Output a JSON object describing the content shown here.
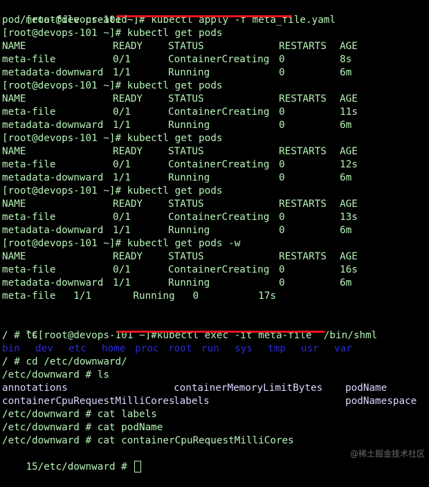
{
  "terminal": {
    "cmd_apply": "[root@devops-101 ~]# kubectl apply -f meta_file.yaml",
    "apply_out": "pod/meta-file created",
    "prompt_get": "[root@devops-101 ~]# kubectl get pods",
    "prompt_watch": "[root@devops-101 ~]# kubectl get pods -w",
    "headers": [
      "NAME",
      "READY",
      "STATUS",
      "RESTARTS",
      "AGE"
    ],
    "snapshots": [
      [
        [
          "meta-file",
          "0/1",
          "ContainerCreating",
          "0",
          "8s"
        ],
        [
          "metadata-downward",
          "1/1",
          "Running",
          "0",
          "6m"
        ]
      ],
      [
        [
          "meta-file",
          "0/1",
          "ContainerCreating",
          "0",
          "11s"
        ],
        [
          "metadata-downward",
          "1/1",
          "Running",
          "0",
          "6m"
        ]
      ],
      [
        [
          "meta-file",
          "0/1",
          "ContainerCreating",
          "0",
          "12s"
        ],
        [
          "metadata-downward",
          "1/1",
          "Running",
          "0",
          "6m"
        ]
      ],
      [
        [
          "meta-file",
          "0/1",
          "ContainerCreating",
          "0",
          "13s"
        ],
        [
          "metadata-downward",
          "1/1",
          "Running",
          "0",
          "6m"
        ]
      ],
      [
        [
          "meta-file",
          "0/1",
          "ContainerCreating",
          "0",
          "16s"
        ],
        [
          "metadata-downward",
          "1/1",
          "Running",
          "0",
          "6m"
        ]
      ]
    ],
    "watch_update": "meta-file   1/1       Running   0          17s",
    "cmd_exec": "^C[root@devops-101 ~]#kubectl exec -it meta-file  /bin/shml",
    "shell_prompt1": "/ # ls",
    "root_dirs": [
      "bin",
      "dev",
      "etc",
      "home",
      "proc",
      "root",
      "run",
      "sys",
      "tmp",
      "usr",
      "var"
    ],
    "cmd_cd": "/ # cd /etc/downward/",
    "cmd_ls2": "/etc/downward # ls",
    "downward_files": [
      [
        "annotations",
        "containerMemoryLimitBytes",
        "podName"
      ],
      [
        "containerCpuRequestMilliCores",
        "labels",
        "podNamespace"
      ]
    ],
    "cmd_cat_labels": "/etc/downward # cat labels",
    "cmd_cat_podname": "/etc/downward # cat podName",
    "cmd_cat_cpu": "/etc/downward # cat containerCpuRequestMilliCores",
    "final_prompt": "15/etc/downward # ",
    "watermark": "@稀土掘金技术社区"
  },
  "colors": {
    "text": "#b6f3b6",
    "dir": "#2b2bd6",
    "files": "#d8d8ff",
    "underline": "#e5161b",
    "background": "#000000"
  }
}
